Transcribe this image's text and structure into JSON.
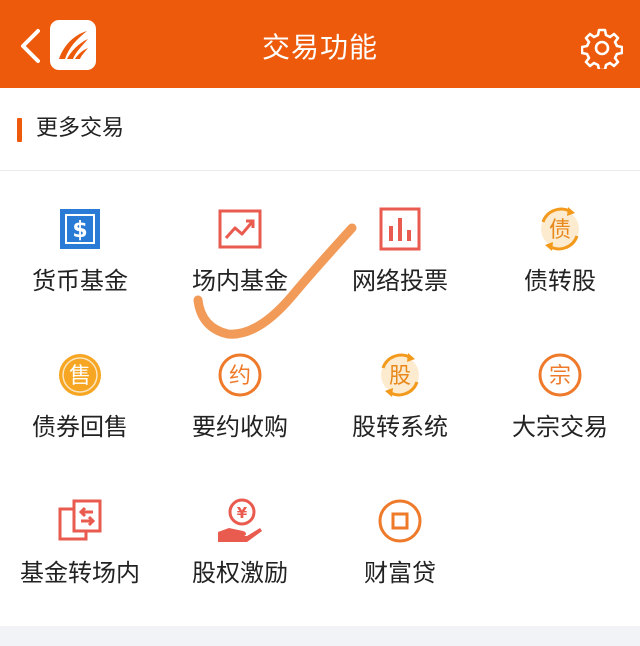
{
  "header": {
    "title": "交易功能",
    "bg_color": "#ee5a0b"
  },
  "section": {
    "title": "更多交易",
    "accent_color": "#ee5a0b"
  },
  "functions": [
    {
      "label": "货币基金",
      "icon": "dollar-square-icon",
      "color": "#2a7bd6"
    },
    {
      "label": "场内基金",
      "icon": "trend-chart-icon",
      "color": "#e95a4f"
    },
    {
      "label": "网络投票",
      "icon": "bar-chart-icon",
      "color": "#e95a4f"
    },
    {
      "label": "债转股",
      "icon": "debt-convert-icon",
      "color": "#f39a1c",
      "glyph": "债"
    },
    {
      "label": "债券回售",
      "icon": "sell-back-icon",
      "color": "#f39a1c",
      "glyph": "售"
    },
    {
      "label": "要约收购",
      "icon": "tender-offer-icon",
      "color": "#ee7a2a",
      "glyph": "约"
    },
    {
      "label": "股转系统",
      "icon": "share-transfer-icon",
      "color": "#f39a1c",
      "glyph": "股"
    },
    {
      "label": "大宗交易",
      "icon": "block-trade-icon",
      "color": "#ee7a2a",
      "glyph": "宗"
    },
    {
      "label": "基金转场内",
      "icon": "fund-transfer-icon",
      "color": "#e95a4f"
    },
    {
      "label": "股权激励",
      "icon": "equity-incentive-icon",
      "color": "#e95a4f",
      "glyph": "¥"
    },
    {
      "label": "财富贷",
      "icon": "wealth-loan-icon",
      "color": "#ee7a2a"
    }
  ]
}
